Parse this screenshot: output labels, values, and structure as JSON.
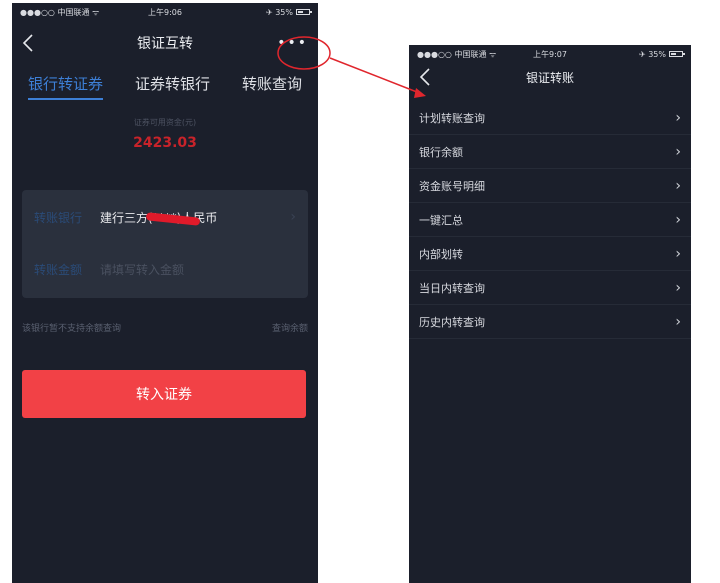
{
  "left_screen": {
    "status": {
      "carrier": "●●●○○ 中国联通 ᯤ",
      "time": "上午9:06",
      "battery": "✈ 35%"
    },
    "nav": {
      "title": "银证互转",
      "more": "•••"
    },
    "tabs": [
      {
        "label": "银行转证券"
      },
      {
        "label": "证券转银行"
      },
      {
        "label": "转账查询"
      }
    ],
    "balance": {
      "label": "证券可用资金(元)",
      "value": "2423.03"
    },
    "form": {
      "bank_label": "转账银行",
      "bank_value": "建行三方(****)人民币",
      "amount_label": "转账金额",
      "amount_placeholder": "请填写转入金额"
    },
    "hint": {
      "left": "该银行暂不支持余额查询",
      "right": "查询余额"
    },
    "submit_label": "转入证券"
  },
  "right_screen": {
    "status": {
      "carrier": "●●●○○ 中国联通 ᯤ",
      "time": "上午9:07",
      "battery": "✈ 35%"
    },
    "nav": {
      "title": "银证转账"
    },
    "menu": [
      {
        "label": "计划转账查询"
      },
      {
        "label": "银行余额"
      },
      {
        "label": "资金账号明细"
      },
      {
        "label": "一键汇总"
      },
      {
        "label": "内部划转"
      },
      {
        "label": "当日内转查询"
      },
      {
        "label": "历史内转查询"
      }
    ]
  },
  "colors": {
    "background": "#1b1f2b",
    "accent": "#3d7fd6",
    "button": "#f24146",
    "annotation": "#e0262d"
  }
}
